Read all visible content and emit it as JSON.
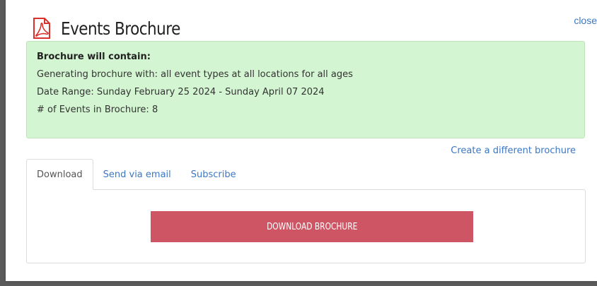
{
  "modal": {
    "title": "Events Brochure",
    "close_label": "close",
    "title_icon": "pdf-file-icon"
  },
  "summary": {
    "heading": "Brochure will contain:",
    "lines": [
      "Generating brochure with: all event types at all locations for all ages",
      "Date Range: Sunday February 25 2024 - Sunday April 07 2024",
      "# of Events in Brochure: 8"
    ]
  },
  "links": {
    "create_different": "Create a different brochure"
  },
  "tabs": [
    {
      "label": "Download",
      "active": true
    },
    {
      "label": "Send via email",
      "active": false
    },
    {
      "label": "Subscribe",
      "active": false
    }
  ],
  "download": {
    "button_label": "DOWNLOAD BROCHURE"
  },
  "colors": {
    "accent_link": "#3c78c4",
    "summary_bg": "#d3f5d1",
    "button_bg": "#cd5564",
    "icon_red": "#d9312b"
  }
}
